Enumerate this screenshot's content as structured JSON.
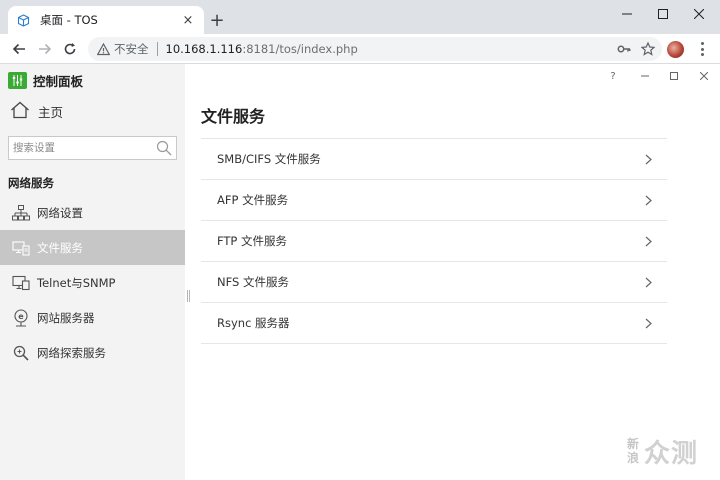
{
  "browser": {
    "tab_title": "桌面 - TOS",
    "tab_close": "×",
    "new_tab": "+",
    "security_label": "不安全",
    "url_host": "10.168.1.116",
    "url_rest": ":8181/tos/index.php"
  },
  "app": {
    "control_panel_title": "控制面板",
    "home_label": "主页",
    "search_placeholder": "搜索设置",
    "section_title": "网络服务",
    "nav_items": [
      {
        "label": "网络设置",
        "icon": "network-icon"
      },
      {
        "label": "文件服务",
        "icon": "file-service-icon",
        "active": true
      },
      {
        "label": "Telnet与SNMP",
        "icon": "monitor-icon"
      },
      {
        "label": "网站服务器",
        "icon": "web-server-icon"
      },
      {
        "label": "网络探索服务",
        "icon": "magnifier-icon"
      }
    ],
    "window_help": "?"
  },
  "main": {
    "page_title": "文件服务",
    "services": [
      {
        "label": "SMB/CIFS 文件服务"
      },
      {
        "label": "AFP 文件服务"
      },
      {
        "label": "FTP 文件服务"
      },
      {
        "label": "NFS 文件服务"
      },
      {
        "label": "Rsync 服务器"
      }
    ]
  },
  "watermark": {
    "small_top": "新",
    "small_bottom": "浪",
    "big": "众测"
  },
  "colors": {
    "accent_green": "#3aaa35",
    "active_nav_bg": "#c6c6c6",
    "sidebar_bg": "#f3f3f3"
  }
}
